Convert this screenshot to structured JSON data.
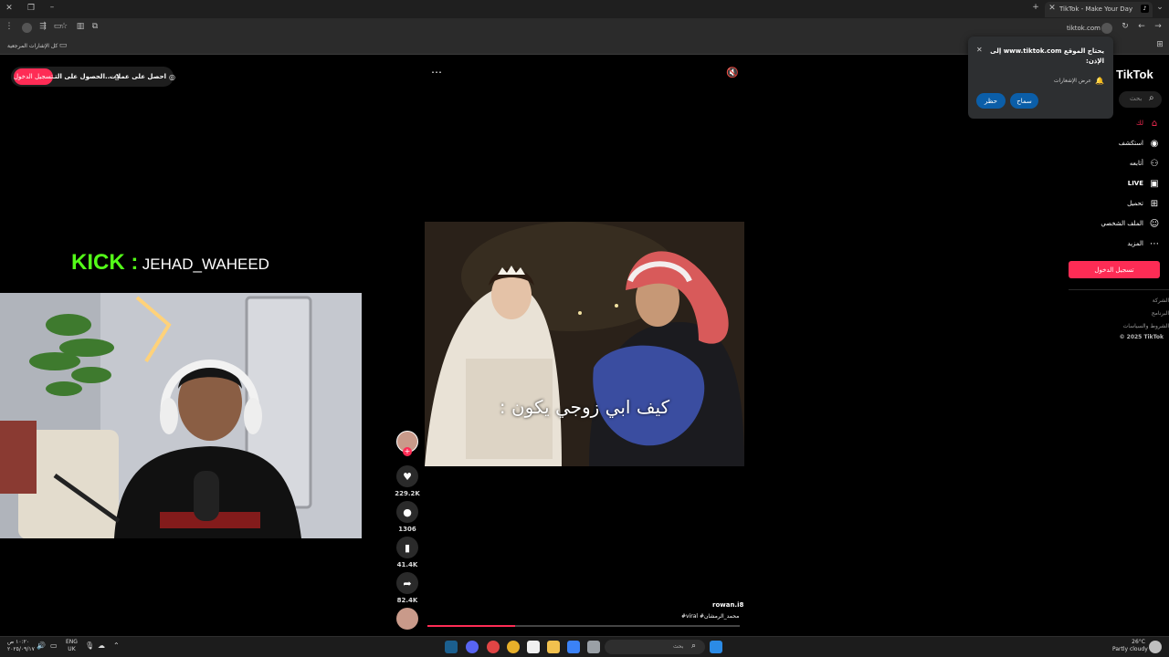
{
  "browser": {
    "tab_title": "TikTok - Make Your Day",
    "url": "tiktok.com",
    "bookmarks_label": "كل الإشارات المرجعية"
  },
  "overlay": {
    "kick_label": "KICK :",
    "kick_user": "JEHAD_WAHEED"
  },
  "top_bar": {
    "login_button": "تسجيل الدخول",
    "get_app": "الحصول على التـ...",
    "get_coins": "احصل على عملات"
  },
  "video": {
    "caption": "كيف ابي زوجي يكون :",
    "author": "rowan.i8",
    "hashtags": "#viral #محمد_الرمشان"
  },
  "actions": {
    "likes": "229.2K",
    "comments": "1306",
    "saves": "41.4K",
    "shares": "82.4K"
  },
  "sidebar": {
    "brand": "TikTok",
    "search_placeholder": "بحث",
    "items": [
      {
        "label": "لك",
        "icon": "home-icon"
      },
      {
        "label": "استكشف",
        "icon": "compass-icon"
      },
      {
        "label": "أتابعه",
        "icon": "following-icon"
      },
      {
        "label": "LIVE",
        "icon": "live-icon"
      },
      {
        "label": "تحميل",
        "icon": "upload-icon"
      },
      {
        "label": "الملف الشخصي",
        "icon": "profile-icon"
      },
      {
        "label": "المزيد",
        "icon": "more-icon"
      }
    ],
    "login_button": "تسجيل الدخول",
    "footer": [
      "الشركة",
      "البرنامج",
      "الشروط والسياسات",
      "© 2025 TikTok"
    ]
  },
  "permission_popup": {
    "title": "يحتاج الموقع www.tiktok.com إلى الإذن:",
    "permission": "عرض الإشعارات",
    "allow": "سماح",
    "block": "حظر"
  },
  "taskbar": {
    "time": "١٠:٢٠ ص",
    "date": "٢٠٢٥/٠٩/١٧",
    "language": "ENG",
    "region": "UK",
    "search_placeholder": "بحث",
    "temperature": "26°C",
    "weather": "Partly cloudy"
  },
  "colors": {
    "tiktok_red": "#fe2c55",
    "kick_green": "#53fc18",
    "popup_button": "#0b5ea8"
  }
}
